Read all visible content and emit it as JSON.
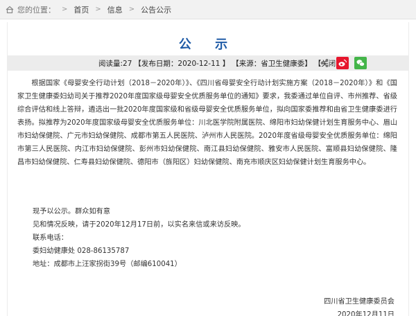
{
  "breadcrumb": {
    "location_label": "您的位置：",
    "home": "首页",
    "sep1": ">",
    "info": "信息",
    "sep2": ">",
    "current": "公告公示"
  },
  "article": {
    "title": "公 示",
    "meta": {
      "views": "阅读量:27",
      "date": "【发布日期：2020-12-11 】",
      "source": "【来源：省卫生健康委】",
      "close": "【关闭 】"
    },
    "share_icons": [
      "share-icon",
      "weibo-icon",
      "wechat-icon"
    ],
    "paragraph": "根据国家《母婴安全行动计划（2018－2020年）》、《四川省母婴安全行动计划实施方案（2018－2020年）》和《国家卫生健康委妇幼司关于推荐2020年度国家级母婴安全优质服务单位的通知》要求，我委通过单位自评、市州推荐、省级综合评估和线上答辩，遴选出一批2020年度国家级和省级母婴安全优质服务单位，拟向国家委推荐和由省卫生健康委进行表扬。拟推荐为2020年度国家级母婴安全优质服务单位：川北医学院附属医院、绵阳市妇幼保健计划生育服务中心、眉山市妇幼保健院、广元市妇幼保健院、成都市第五人民医院、泸州市人民医院。2020年度省级母婴安全优质服务单位：绵阳市第三人民医院、内江市妇幼保健院、彭州市妇幼保健院、南江县妇幼保健院、雅安市人民医院、富顺县妇幼保健院、隆昌市妇幼保健院、仁寿县妇幼保健院、德阳市（旌阳区）妇幼保健院、南充市顺庆区妇幼保健计划生育服务中心。",
    "lines": [
      "现予以公示。群众如有意",
      "见和情况反映，请于2020年12月17日前，以实名来信或来访反映。",
      "联系电话：",
      "委妇幼健康处  028-86135787",
      "地址：成都市上汪家拐街39号（邮编610041）"
    ],
    "signature": {
      "org": "四川省卫生健康委员会",
      "date": "2020年12月11日"
    }
  },
  "colors": {
    "title": "#1d5aa6",
    "weibo": "#e6162d",
    "wechat": "#44b549"
  }
}
